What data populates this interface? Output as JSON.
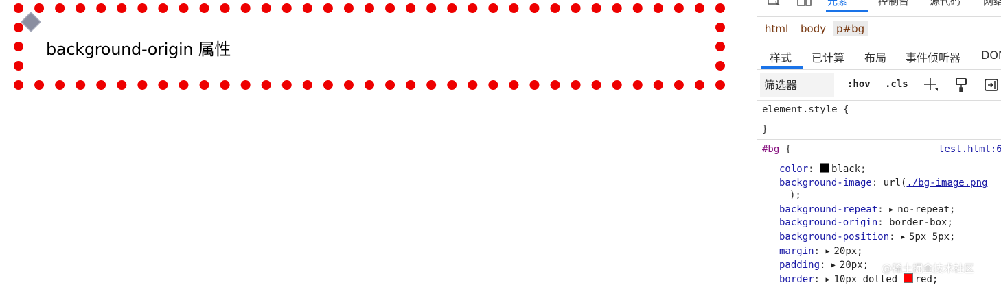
{
  "page": {
    "paragraph_text": "background-origin 属性",
    "border_color": "#ee0000",
    "bg_image_color": "#8a8ea0"
  },
  "devtools": {
    "toolbar_tabs": [
      "元素",
      "控制台",
      "源代码",
      "网络"
    ],
    "breadcrumbs": [
      "html",
      "body",
      "p#bg"
    ],
    "subtabs": [
      "样式",
      "已计算",
      "布局",
      "事件侦听器",
      "DOM"
    ],
    "filter_placeholder": "筛选器",
    "hov_label": ":hov",
    "cls_label": ".cls",
    "element_style_open": "element.style {",
    "element_style_close": "}",
    "rule": {
      "selector": "#bg",
      "open_brace": "{",
      "source": "test.html:6",
      "properties": [
        {
          "name": "color",
          "value": "black",
          "swatch": "#000000",
          "expandable": false
        },
        {
          "name": "background-image",
          "value_prefix": "url(",
          "value_link": "./bg-image.png",
          "value_suffix": ");",
          "expandable": false
        },
        {
          "name": "background-repeat",
          "value": "no-repeat;",
          "expandable": true
        },
        {
          "name": "background-origin",
          "value": "border-box;",
          "expandable": false
        },
        {
          "name": "background-position",
          "value": "5px 5px;",
          "expandable": true
        },
        {
          "name": "margin",
          "value": "20px;",
          "expandable": true
        },
        {
          "name": "padding",
          "value": "20px;",
          "expandable": true
        },
        {
          "name": "border",
          "value_prefix": "10px dotted",
          "value": "red;",
          "swatch": "#ff0000",
          "expandable": true
        }
      ]
    }
  },
  "watermark": "@稀土掘金技术社区"
}
